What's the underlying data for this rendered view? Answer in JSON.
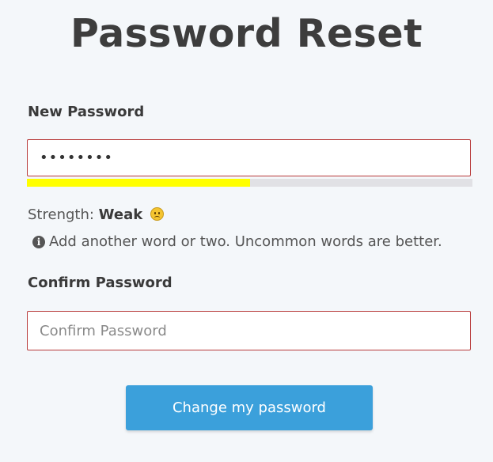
{
  "page": {
    "title": "Password Reset"
  },
  "new_password": {
    "label": "New Password",
    "value": "••••••••",
    "strength_fraction": 0.5
  },
  "strength": {
    "prefix": "Strength:",
    "level": "Weak",
    "meter_color": "#ffff00",
    "emoji": "frowning-face-icon"
  },
  "hint": {
    "icon": "info-icon",
    "text": "Add another word or two. Uncommon words are better."
  },
  "confirm_password": {
    "label": "Confirm Password",
    "placeholder": "Confirm Password",
    "value": ""
  },
  "submit": {
    "label": "Change my password",
    "color": "#3ba0db"
  }
}
